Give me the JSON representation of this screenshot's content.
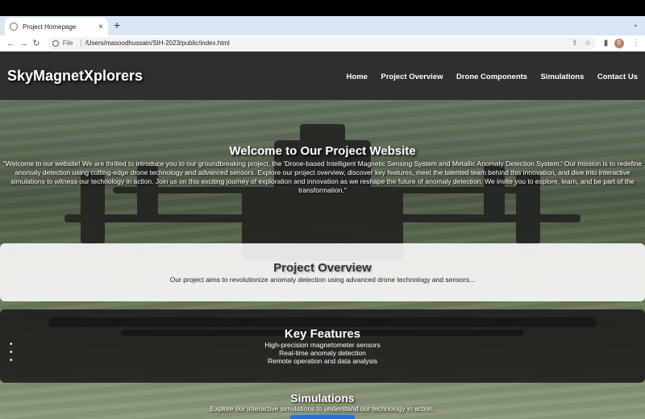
{
  "browser": {
    "tab_title": "Project Homepage",
    "tab_close": "×",
    "new_tab": "+",
    "tab_menu": "⌄",
    "back": "←",
    "forward": "→",
    "reload": "↻",
    "omnibox_label": "File",
    "url": "/Users/masoodhussain/SIH-2023/public/index.html",
    "share_icon": "⇪",
    "bookmark_icon": "☆",
    "sidebar_icon": "▮",
    "avatar_letter": "E",
    "menu_icon": "⋮"
  },
  "header": {
    "brand": "SkyMagnetXplorers",
    "nav": [
      "Home",
      "Project Overview",
      "Drone Components",
      "Simulations",
      "Contact Us"
    ]
  },
  "hero": {
    "title": "Welcome to Our Project Website",
    "text": "\"Welcome to our website! We are thrilled to introduce you to our groundbreaking project, the 'Drone-based Intelligent Magnetic Sensing System and Metallic Anomaly Detection System.' Our mission is to redefine anomaly detection using cutting-edge drone technology and advanced sensors. Explore our project overview, discover key features, meet the talented team behind this innovation, and dive into interactive simulations to witness our technology in action. Join us on this exciting journey of exploration and innovation as we reshape the future of anomaly detection. We invite you to explore, learn, and be part of the transformation.\""
  },
  "overview": {
    "title": "Project Overview",
    "text": "Our project aims to revolutionize anomaly detection using advanced drone technology and sensors..."
  },
  "features": {
    "title": "Key Features",
    "items": [
      "High-precision magnetometer sensors",
      "Real-time anomaly detection",
      "Remote operation and data analysis"
    ]
  },
  "simulations": {
    "title": "Simulations",
    "text": "Explore our interactive simulations to understand our technology in action."
  }
}
